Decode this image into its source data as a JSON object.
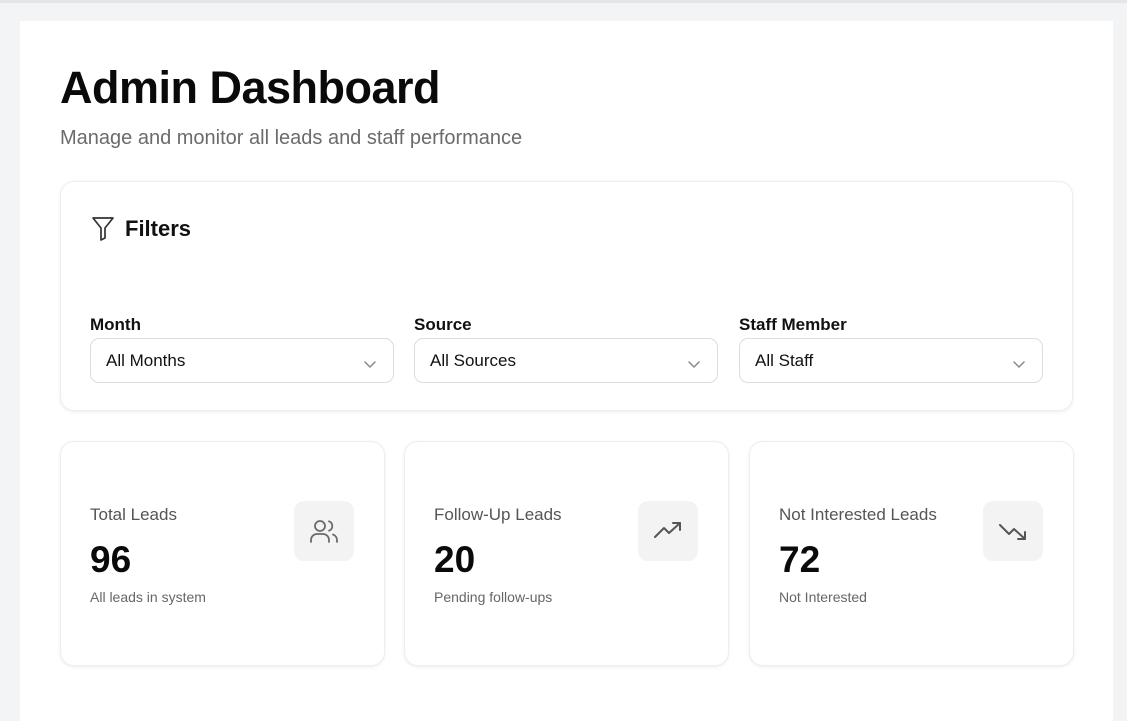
{
  "header": {
    "title": "Admin Dashboard",
    "subtitle": "Manage and monitor all leads and staff performance"
  },
  "filters": {
    "title": "Filters",
    "icon": "filter-icon",
    "fields": [
      {
        "label": "Month",
        "value": "All Months"
      },
      {
        "label": "Source",
        "value": "All Sources"
      },
      {
        "label": "Staff Member",
        "value": "All Staff"
      }
    ]
  },
  "stats": [
    {
      "label": "Total Leads",
      "value": "96",
      "sub": "All leads in system",
      "icon": "users-icon"
    },
    {
      "label": "Follow-Up Leads",
      "value": "20",
      "sub": "Pending follow-ups",
      "icon": "trending-up-icon"
    },
    {
      "label": "Not Interested Leads",
      "value": "72",
      "sub": "Not Interested",
      "icon": "trending-down-icon"
    }
  ],
  "colors": {
    "page_bg": "#f3f4f6",
    "card_bg": "#ffffff",
    "muted_text": "#6b6b6b",
    "icon_tile": "#f3f3f4"
  }
}
